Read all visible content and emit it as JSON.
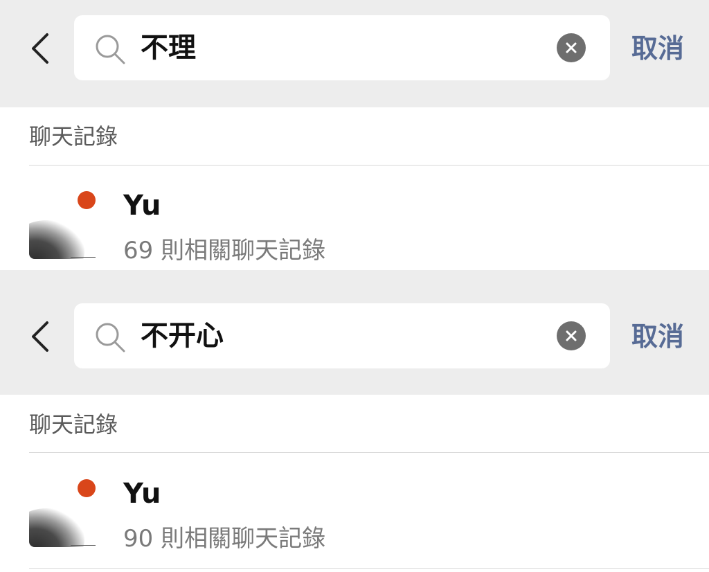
{
  "screens": [
    {
      "search": {
        "query": "不理",
        "cancel_label": "取消"
      },
      "section_title": "聊天記錄",
      "result": {
        "name": "Yu",
        "count_text": "69 則相關聊天記錄"
      }
    },
    {
      "search": {
        "query": "不开心",
        "cancel_label": "取消"
      },
      "section_title": "聊天記錄",
      "result": {
        "name": "Yu",
        "count_text": "90 則相關聊天記錄"
      }
    }
  ],
  "colors": {
    "topbar_bg": "#ededed",
    "cancel_text": "#576b95",
    "clear_button": "#6e6e6e",
    "avatar_dot": "#d9461a"
  },
  "icons": [
    "back-chevron-icon",
    "search-icon",
    "clear-icon"
  ]
}
